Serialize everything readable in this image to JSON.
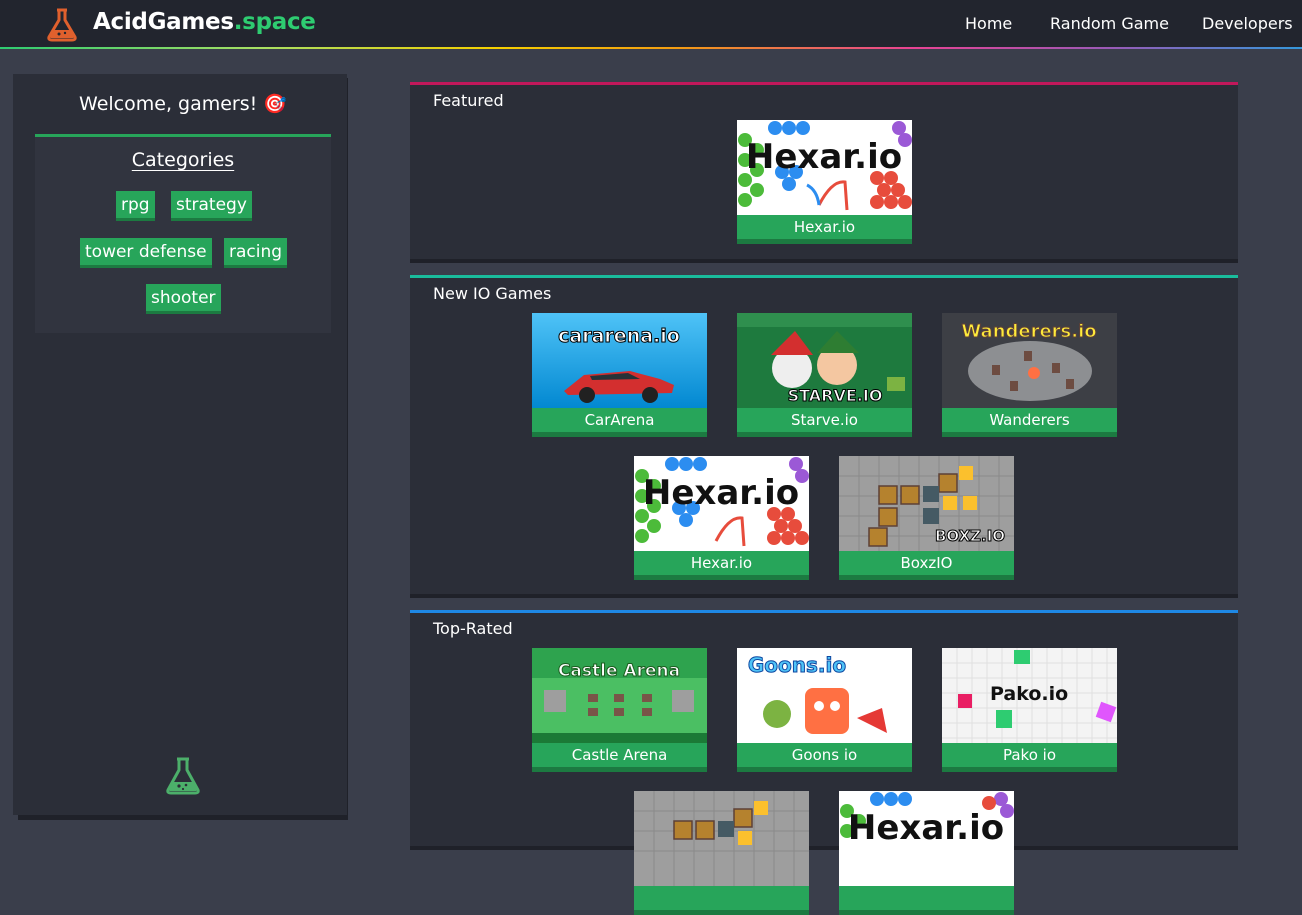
{
  "header": {
    "brand_main": "AcidGames",
    "brand_tld": ".space",
    "nav": [
      {
        "label": "Home"
      },
      {
        "label": "Random Game"
      },
      {
        "label": "Developers"
      }
    ]
  },
  "sidebar": {
    "welcome": "Welcome, gamers! 🎯",
    "categories_title": "Categories",
    "categories": [
      "rpg",
      "strategy",
      "tower defense",
      "racing",
      "shooter"
    ]
  },
  "sections": [
    {
      "title": "Featured",
      "games": [
        {
          "name": "Hexar.io",
          "thumb_text": "Hexar.io",
          "icon": "hexar-thumbnail"
        }
      ]
    },
    {
      "title": "New IO Games",
      "games": [
        {
          "name": "CarArena",
          "thumb_text": "cararena.io",
          "icon": "cararena-thumbnail"
        },
        {
          "name": "Starve.io",
          "thumb_text": "STARVE.IO",
          "icon": "starve-thumbnail"
        },
        {
          "name": "Wanderers",
          "thumb_text": "Wanderers.io",
          "icon": "wanderers-thumbnail"
        },
        {
          "name": "Hexar.io",
          "thumb_text": "Hexar.io",
          "icon": "hexar-thumbnail"
        },
        {
          "name": "BoxzIO",
          "thumb_text": "BOXZ.IO",
          "icon": "boxz-thumbnail"
        }
      ]
    },
    {
      "title": "Top-Rated",
      "games": [
        {
          "name": "Castle Arena",
          "thumb_text": "Castle Arena",
          "icon": "castle-arena-thumbnail"
        },
        {
          "name": "Goons io",
          "thumb_text": "Goons.io",
          "icon": "goons-thumbnail"
        },
        {
          "name": "Pako io",
          "thumb_text": "Pako.io",
          "icon": "pako-thumbnail"
        },
        {
          "name": "",
          "thumb_text": "",
          "icon": "boxz-thumbnail"
        },
        {
          "name": "",
          "thumb_text": "Hexar.io",
          "icon": "hexar-thumbnail"
        }
      ]
    }
  ],
  "colors": {
    "accent_green": "#27a55a",
    "featured_border": "#c2185b",
    "new_border": "#1abc9c",
    "top_border": "#1e88e5"
  }
}
